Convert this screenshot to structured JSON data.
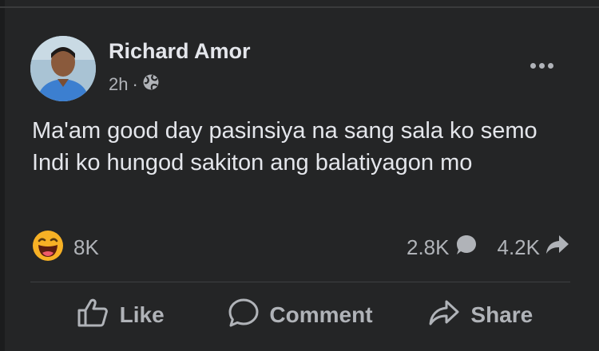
{
  "post": {
    "author": "Richard Amor",
    "timestamp": "2h",
    "separator": "·",
    "audience_icon": "globe-icon",
    "more_icon": "more-options-icon",
    "text_lines": [
      "Ma'am good day pasinsiya na sang sala ko semo",
      "Indi ko hungod sakiton ang balatiyagon mo"
    ]
  },
  "engagement": {
    "reaction_icon": "laughing-emoji-icon",
    "reaction_count": "8K",
    "comment_count": "2.8K",
    "comment_icon": "comment-bubble-icon",
    "share_count": "4.2K",
    "share_icon": "share-arrow-icon"
  },
  "actions": {
    "like_label": "Like",
    "comment_label": "Comment",
    "share_label": "Share"
  },
  "colors": {
    "background": "#242526",
    "primary_text": "#e4e6eb",
    "secondary_text": "#b0b3b8",
    "emoji_yellow": "#f7b125"
  }
}
